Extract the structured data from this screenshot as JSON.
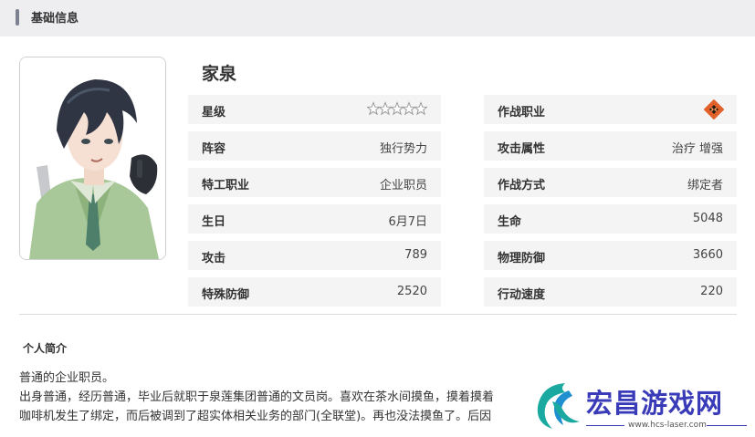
{
  "section": {
    "title": "基础信息"
  },
  "character": {
    "name": "家泉"
  },
  "stats_left": [
    {
      "label": "星级",
      "value": ""
    },
    {
      "label": "阵容",
      "value": "独行势力"
    },
    {
      "label": "特工职业",
      "value": "企业职员"
    },
    {
      "label": "生日",
      "value": "6月7日"
    },
    {
      "label": "攻击",
      "value": "789"
    },
    {
      "label": "特殊防御",
      "value": "2520"
    }
  ],
  "stats_right": [
    {
      "label": "作战职业",
      "value": ""
    },
    {
      "label": "攻击属性",
      "value": "治疗 增强"
    },
    {
      "label": "作战方式",
      "value": "绑定者"
    },
    {
      "label": "生命",
      "value": "5048"
    },
    {
      "label": "物理防御",
      "value": "3660"
    },
    {
      "label": "行动速度",
      "value": "220"
    }
  ],
  "star_rating": {
    "stars": 5,
    "icon": "star-outline-icon"
  },
  "combat_class_icon": {
    "icon": "class-emblem-icon",
    "color": "#e2602a"
  },
  "intro": {
    "title": "个人简介",
    "lines": [
      "普通的企业职员。",
      "出身普通，经历普通，毕业后就职于泉莲集团普通的文员岗。喜欢在茶水间摸鱼，摸着摸着",
      "咖啡机发生了绑定，而后被调到了超实体相关业务的部门(全联堂)。再也没法摸鱼了。后因"
    ]
  },
  "watermark": {
    "text": "宏昌游戏网",
    "url": "www.hcs-laser.com",
    "color": "#3a3bb8"
  }
}
